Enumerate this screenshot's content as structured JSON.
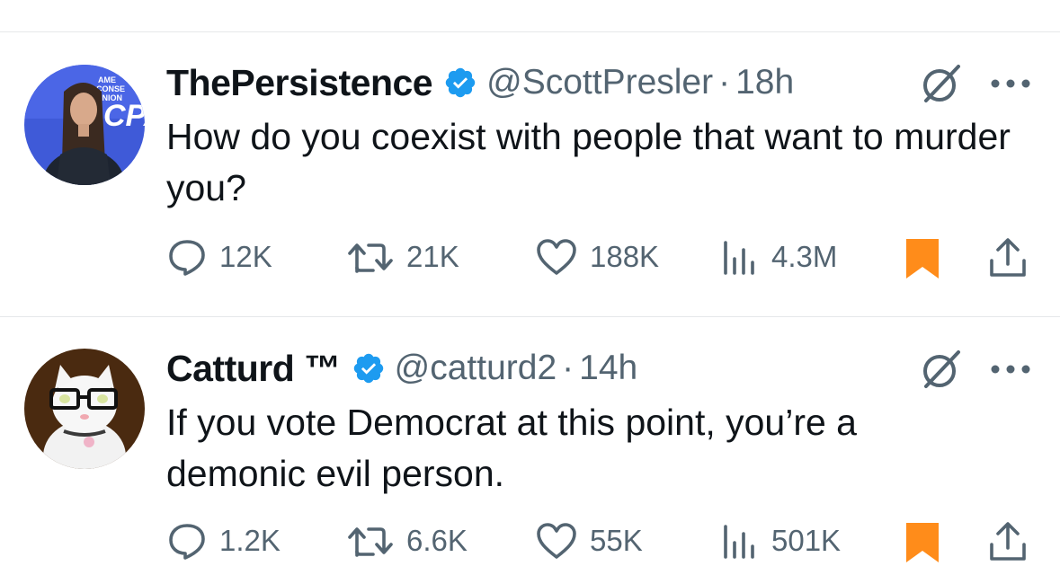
{
  "tweets": [
    {
      "name": "ThePersistence",
      "handle": "@ScottPresler",
      "separator": "·",
      "time": "18h",
      "text": "How do you coexist with people that want to murder you?",
      "replies": "12K",
      "reposts": "21K",
      "likes": "188K",
      "views": "4.3M",
      "avatar_logo_text": [
        "AME",
        "CONSE",
        "UNION",
        "CPA"
      ],
      "bookmarked": true
    },
    {
      "name": "Catturd ™",
      "handle": "@catturd2",
      "separator": "·",
      "time": "14h",
      "text": "If you vote Democrat at this point, you’re a demonic evil person.",
      "replies": "1.2K",
      "reposts": "6.6K",
      "likes": "55K",
      "views": "501K",
      "bookmarked": true
    }
  ],
  "colors": {
    "verified": "#1d9bf0",
    "bookmark": "#ff8c1a",
    "secondary_text": "#536471",
    "primary_text": "#0f1419",
    "divider": "#e6e8ea"
  },
  "icons": [
    "reply-icon",
    "repost-icon",
    "like-icon",
    "views-icon",
    "bookmark-icon",
    "share-icon",
    "grok-icon",
    "more-icon",
    "verified-badge-icon"
  ]
}
